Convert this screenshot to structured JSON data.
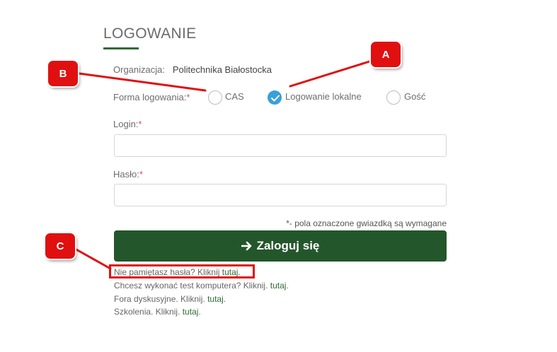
{
  "page": {
    "title": "LOGOWANIE"
  },
  "organization": {
    "label": "Organizacja:",
    "value": "Politechnika Białostocka"
  },
  "login_form": {
    "label": "Forma logowania:",
    "required_mark": "*",
    "options": [
      {
        "label": "CAS",
        "checked": false
      },
      {
        "label": "Logowanie lokalne",
        "checked": true
      },
      {
        "label": "Gość",
        "checked": false
      }
    ]
  },
  "login_field": {
    "label": "Login:",
    "required_mark": "*",
    "value": "",
    "placeholder": ""
  },
  "password_field": {
    "label": "Hasło:",
    "required_mark": "*",
    "value": "",
    "placeholder": ""
  },
  "required_note": "*- pola oznaczone gwiazdką są wymagane",
  "submit": {
    "label": "Zaloguj się",
    "icon": "arrow-right-icon"
  },
  "links": [
    {
      "text": "Nie pamiętasz hasła? Kliknij",
      "link": "tutaj",
      "suffix": "."
    },
    {
      "text": "Chcesz wykonać test komputera? Kliknij.",
      "link": "tutaj",
      "suffix": "."
    },
    {
      "text": "Fora dyskusyjne. Kliknij.",
      "link": "tutaj",
      "suffix": "."
    },
    {
      "text": "Szkolenia. Kliknij.",
      "link": "tutaj",
      "suffix": "."
    }
  ],
  "callouts": {
    "a": "A",
    "b": "B",
    "c": "C"
  },
  "colors": {
    "accent": "#24562b",
    "annotation": "#e01010",
    "radio_checked": "#3aa0d8",
    "required": "#d9534f"
  }
}
